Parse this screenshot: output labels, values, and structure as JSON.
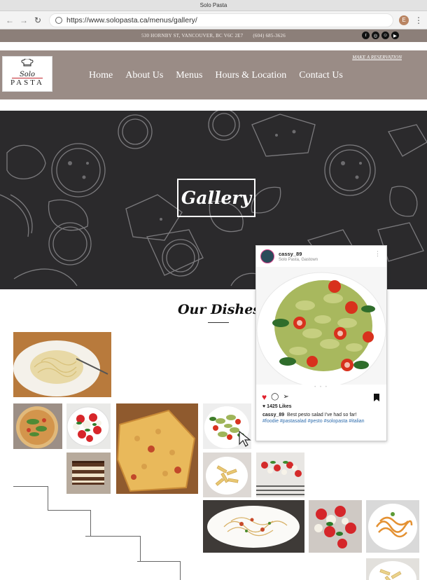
{
  "window": {
    "title": "Solo Pasta"
  },
  "browser": {
    "url": "https://www.solopasta.ca/menus/gallery/",
    "avatar_letter": "E"
  },
  "infobar": {
    "address": "530 HORNBY ST, VANCOUVER, BC V6C 2E7",
    "phone": "(604) 685-3626",
    "social_icons": [
      "facebook-icon",
      "instagram-icon",
      "snapchat-icon",
      "youtube-icon"
    ]
  },
  "header": {
    "logo_line1": "Solo",
    "logo_line2": "PASTA",
    "nav": [
      "Home",
      "About Us",
      "Menus",
      "Hours & Location",
      "Contact Us"
    ],
    "reserve_link": "MAKE A RESERVATION"
  },
  "hero": {
    "title": "Gallery"
  },
  "section": {
    "title": "Our Dishes"
  },
  "instagram": {
    "username": "cassy_89",
    "location": "Solo Pasta, Gastown",
    "likes": "1425 Likes",
    "caption_user": "cassy_89",
    "caption_text": "Best pesto salad I've had so far!",
    "hashtags": "#foodie #pastasalad #pesto #solopasta #italian"
  },
  "colors": {
    "header_bg": "#9a8c86",
    "infobar_bg": "#8c7f79",
    "hero_bg": "#2b2a2c",
    "hashtag": "#2f6dad",
    "like_heart": "#e0202c"
  }
}
